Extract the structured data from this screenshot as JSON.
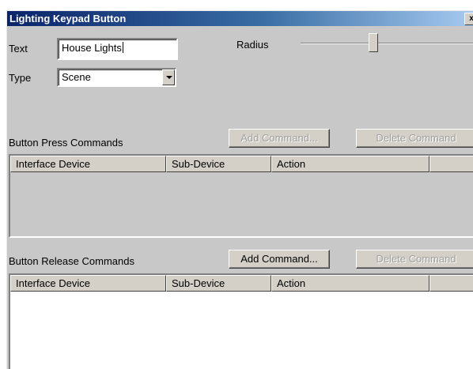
{
  "window": {
    "title": "Lighting Keypad Button",
    "close_glyph": "x"
  },
  "form": {
    "text_label": "Text",
    "text_value": "House Lights",
    "type_label": "Type",
    "type_value": "Scene",
    "radius_label": "Radius",
    "radius_value_fraction": 0.42
  },
  "press": {
    "section_label": "Button Press Commands",
    "add_label": "Add Command...",
    "delete_label": "Delete Command",
    "columns": [
      "Interface Device",
      "Sub-Device",
      "Action",
      ""
    ]
  },
  "release": {
    "section_label": "Button Release Commands",
    "add_label": "Add Command...",
    "delete_label": "Delete Command",
    "columns": [
      "Interface Device",
      "Sub-Device",
      "Action",
      ""
    ]
  },
  "colors": {
    "dialog_bg": "#c8c8c8",
    "title_gradient_start": "#0a246a",
    "title_gradient_end": "#a6caf0",
    "disabled_list_bg": "#c8c8c8",
    "enabled_list_bg": "#ffffff"
  }
}
